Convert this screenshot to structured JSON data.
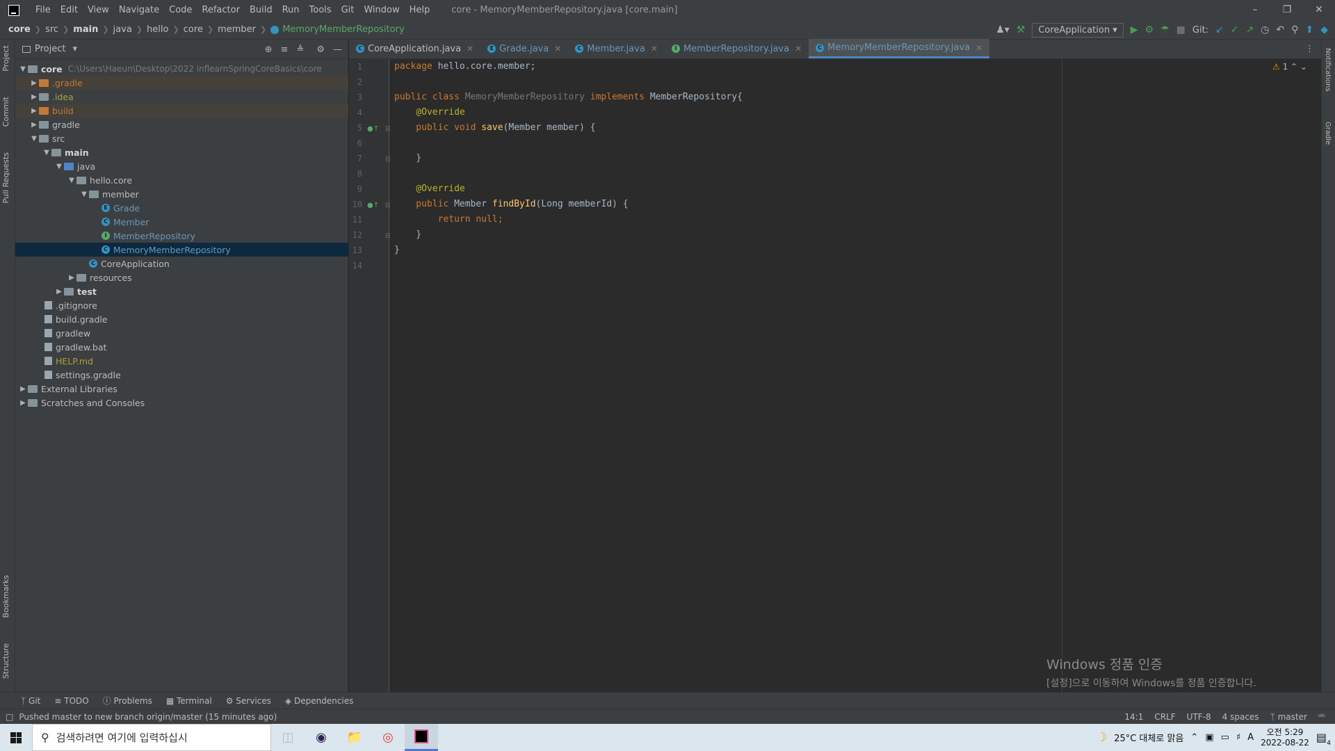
{
  "window": {
    "title": "core - MemoryMemberRepository.java [core.main]",
    "menu": [
      "File",
      "Edit",
      "View",
      "Navigate",
      "Code",
      "Refactor",
      "Build",
      "Run",
      "Tools",
      "Git",
      "Window",
      "Help"
    ]
  },
  "breadcrumb": [
    "core",
    "src",
    "main",
    "java",
    "hello",
    "core",
    "member",
    "MemoryMemberRepository"
  ],
  "toolbar": {
    "run_config": "CoreApplication",
    "git_label": "Git:"
  },
  "left_strip": {
    "project": "Project",
    "commit": "Commit",
    "pull_requests": "Pull Requests",
    "bookmarks": "Bookmarks",
    "structure": "Structure"
  },
  "right_strip": {
    "notifications": "Notifications",
    "gradle": "Gradle"
  },
  "project_panel": {
    "title": "Project",
    "tree": [
      {
        "label": "core",
        "path": "C:\\Users\\Haeun\\Desktop\\2022 inflearnSpringCoreBasics\\core"
      },
      {
        "label": ".gradle"
      },
      {
        "label": ".idea"
      },
      {
        "label": "build"
      },
      {
        "label": "gradle"
      },
      {
        "label": "src"
      },
      {
        "label": "main"
      },
      {
        "label": "java"
      },
      {
        "label": "hello.core"
      },
      {
        "label": "member"
      },
      {
        "label": "Grade"
      },
      {
        "label": "Member"
      },
      {
        "label": "MemberRepository"
      },
      {
        "label": "MemoryMemberRepository"
      },
      {
        "label": "CoreApplication"
      },
      {
        "label": "resources"
      },
      {
        "label": "test"
      },
      {
        "label": ".gitignore"
      },
      {
        "label": "build.gradle"
      },
      {
        "label": "gradlew"
      },
      {
        "label": "gradlew.bat"
      },
      {
        "label": "HELP.md"
      },
      {
        "label": "settings.gradle"
      },
      {
        "label": "External Libraries"
      },
      {
        "label": "Scratches and Consoles"
      }
    ]
  },
  "tabs": [
    {
      "label": "CoreApplication.java"
    },
    {
      "label": "Grade.java"
    },
    {
      "label": "Member.java"
    },
    {
      "label": "MemberRepository.java"
    },
    {
      "label": "MemoryMemberRepository.java"
    }
  ],
  "editor": {
    "line_numbers": [
      "1",
      "2",
      "3",
      "4",
      "5",
      "6",
      "7",
      "8",
      "9",
      "10",
      "11",
      "12",
      "13",
      "14"
    ],
    "warning_count": "1",
    "code": {
      "l1a": "package",
      "l1b": " hello.core.member;",
      "l3a": "public class",
      "l3b": " MemoryMemberRepository",
      "l3c": " implements",
      "l3d": " MemberRepository{",
      "l4": "    @Override",
      "l5a": "    public void",
      "l5b": " save",
      "l5c": "(Member member) {",
      "l7": "    }",
      "l9": "    @Override",
      "l10a": "    public",
      "l10b": " Member ",
      "l10c": "findById",
      "l10d": "(Long memberId) {",
      "l11a": "        return null",
      "l11b": ";",
      "l12": "    }",
      "l13": "}"
    }
  },
  "watermark": {
    "line1": "Windows 정품 인증",
    "line2": "[설정]으로 이동하여 Windows를 정품 인증합니다."
  },
  "tool_windows": [
    "Git",
    "TODO",
    "Problems",
    "Terminal",
    "Services",
    "Dependencies"
  ],
  "status": {
    "message": "Pushed master to new branch origin/master (15 minutes ago)",
    "position": "14:1",
    "line_sep": "CRLF",
    "encoding": "UTF-8",
    "indent": "4 spaces",
    "branch": "master"
  },
  "taskbar": {
    "search_placeholder": "검색하려면 여기에 입력하십시",
    "weather": "25°C 대체로 맑음",
    "time": "오전 5:29",
    "date": "2022-08-22",
    "notif_count": "4"
  }
}
